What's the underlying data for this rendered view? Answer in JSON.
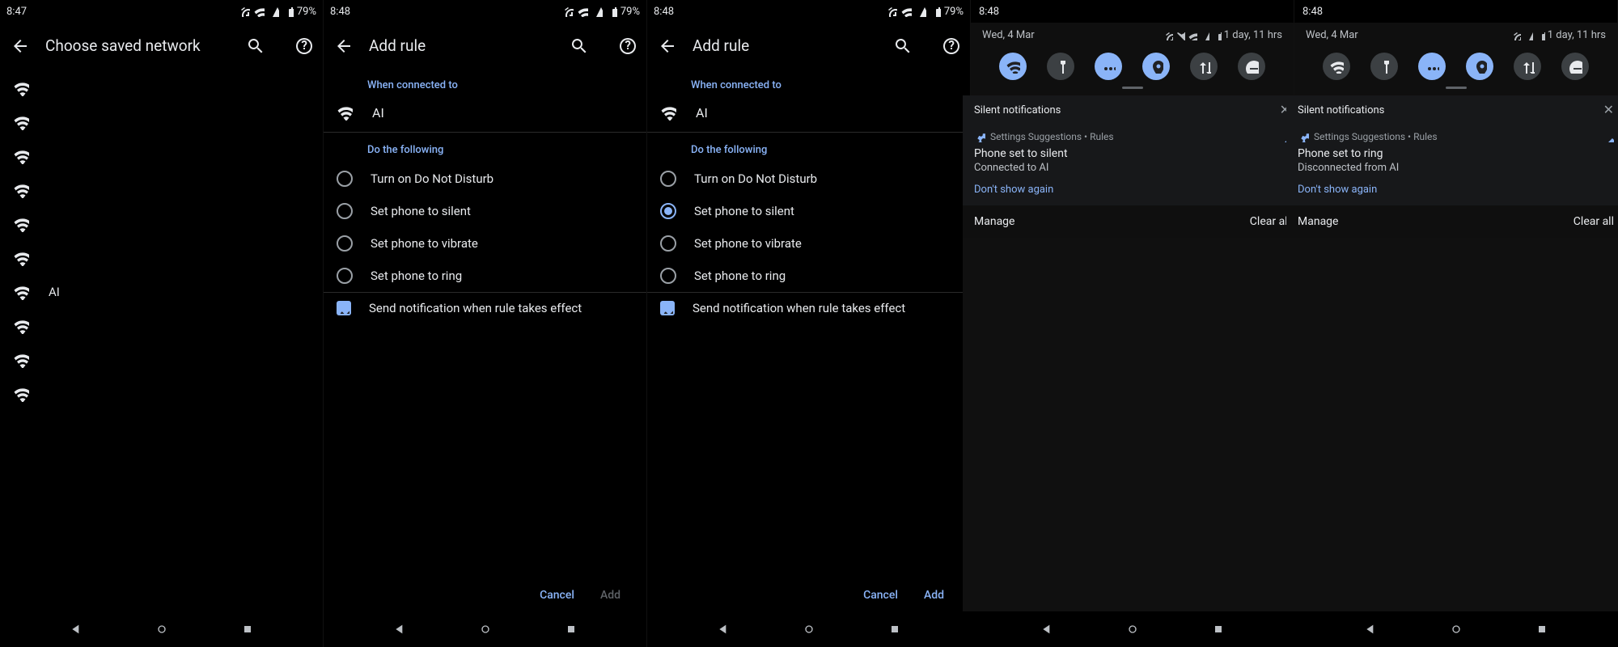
{
  "panels": [
    {
      "status": {
        "time": "8:47",
        "battery": "79%"
      },
      "title": "Choose saved network",
      "networks": [
        "",
        "",
        "",
        "",
        "",
        "",
        "AI",
        "",
        "",
        ""
      ],
      "labeled_network": "AI"
    },
    {
      "status": {
        "time": "8:48",
        "battery": "79%"
      },
      "title": "Add rule",
      "section_when": "When connected to",
      "net": "AI",
      "section_do": "Do the following",
      "options": [
        {
          "label": "Turn on Do Not Disturb",
          "checked": false
        },
        {
          "label": "Set phone to silent",
          "checked": false
        },
        {
          "label": "Set phone to vibrate",
          "checked": false
        },
        {
          "label": "Set phone to ring",
          "checked": false
        }
      ],
      "notify_label": "Send notification when rule takes effect",
      "notify_checked": true,
      "cancel": "Cancel",
      "add": "Add",
      "add_enabled": false
    },
    {
      "status": {
        "time": "8:48",
        "battery": "79%"
      },
      "title": "Add rule",
      "section_when": "When connected to",
      "net": "AI",
      "section_do": "Do the following",
      "options": [
        {
          "label": "Turn on Do Not Disturb",
          "checked": false
        },
        {
          "label": "Set phone to silent",
          "checked": true
        },
        {
          "label": "Set phone to vibrate",
          "checked": false
        },
        {
          "label": "Set phone to ring",
          "checked": false
        }
      ],
      "notify_label": "Send notification when rule takes effect",
      "notify_checked": true,
      "cancel": "Cancel",
      "add": "Add",
      "add_enabled": true
    },
    {
      "status_time": "8:48",
      "date": "Wed, 4 Mar",
      "remaining": "1 day, 11 hrs",
      "tiles": [
        {
          "name": "wifi",
          "on": true
        },
        {
          "name": "flashlight",
          "on": false
        },
        {
          "name": "more",
          "on": true
        },
        {
          "name": "location",
          "on": true
        },
        {
          "name": "data",
          "on": false
        },
        {
          "name": "dnd",
          "on": false
        }
      ],
      "silent_header": "Silent notifications",
      "notif": {
        "src": "Settings Suggestions • Rules",
        "title": "Phone set to silent",
        "sub": "Connected to AI",
        "action": "Don't show again"
      },
      "manage": "Manage",
      "clear": "Clear all"
    },
    {
      "status_time": "8:48",
      "date": "Wed, 4 Mar",
      "remaining": "1 day, 11 hrs",
      "tiles": [
        {
          "name": "wifi",
          "on": false
        },
        {
          "name": "flashlight",
          "on": false
        },
        {
          "name": "more",
          "on": true
        },
        {
          "name": "location",
          "on": true
        },
        {
          "name": "data",
          "on": false
        },
        {
          "name": "dnd",
          "on": false
        }
      ],
      "silent_header": "Silent notifications",
      "notif": {
        "src": "Settings Suggestions • Rules",
        "title": "Phone set to ring",
        "sub": "Disconnected from AI",
        "action": "Don't show again"
      },
      "manage": "Manage",
      "clear": "Clear all"
    }
  ]
}
